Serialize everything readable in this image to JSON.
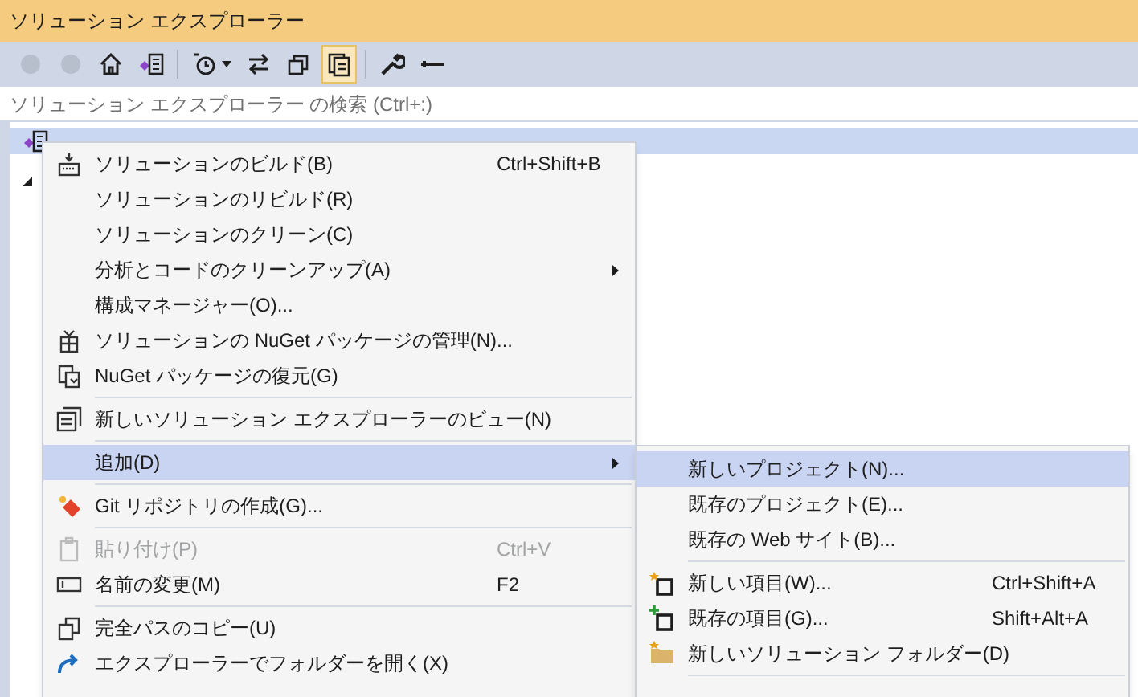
{
  "window": {
    "title": "ソリューション エクスプローラー"
  },
  "toolbar": [
    {
      "disabled": true,
      "selected": false
    },
    {
      "disabled": true,
      "selected": false
    },
    {
      "disabled": false,
      "selected": false
    },
    {
      "disabled": false,
      "selected": false
    },
    {
      "disabled": false,
      "selected": false
    },
    {
      "disabled": false,
      "selected": false
    },
    {
      "disabled": false,
      "selected": false
    },
    {
      "disabled": false,
      "selected": true
    },
    {
      "disabled": false,
      "selected": false
    },
    {
      "disabled": false,
      "selected": false
    }
  ],
  "search": {
    "placeholder": "ソリューション エクスプローラー の検索 (Ctrl+:)"
  },
  "tree": {
    "selected": true,
    "expanded": true
  },
  "context_menu": [
    {
      "kind": "item",
      "label": "ソリューションのビルド(B)",
      "shortcut": "Ctrl+Shift+B",
      "disabled": false,
      "selected": false,
      "submenu": false
    },
    {
      "kind": "item",
      "label": "ソリューションのリビルド(R)",
      "disabled": false,
      "selected": false,
      "submenu": false
    },
    {
      "kind": "item",
      "label": "ソリューションのクリーン(C)",
      "disabled": false,
      "selected": false,
      "submenu": false
    },
    {
      "kind": "item",
      "label": "分析とコードのクリーンアップ(A)",
      "disabled": false,
      "selected": false,
      "submenu": true
    },
    {
      "kind": "item",
      "label": "構成マネージャー(O)...",
      "disabled": false,
      "selected": false,
      "submenu": false
    },
    {
      "kind": "item",
      "label": "ソリューションの NuGet パッケージの管理(N)...",
      "disabled": false,
      "selected": false,
      "submenu": false
    },
    {
      "kind": "item",
      "label": "NuGet パッケージの復元(G)",
      "disabled": false,
      "selected": false,
      "submenu": false
    },
    {
      "kind": "separator"
    },
    {
      "kind": "item",
      "label": "新しいソリューション エクスプローラーのビュー(N)",
      "disabled": false,
      "selected": false,
      "submenu": false
    },
    {
      "kind": "separator"
    },
    {
      "kind": "item",
      "label": "追加(D)",
      "disabled": false,
      "selected": true,
      "submenu": true
    },
    {
      "kind": "separator"
    },
    {
      "kind": "item",
      "label": "Git リポジトリの作成(G)...",
      "disabled": false,
      "selected": false,
      "submenu": false
    },
    {
      "kind": "separator"
    },
    {
      "kind": "item",
      "label": "貼り付け(P)",
      "shortcut": "Ctrl+V",
      "disabled": true,
      "selected": false,
      "submenu": false
    },
    {
      "kind": "item",
      "label": "名前の変更(M)",
      "shortcut": "F2",
      "disabled": false,
      "selected": false,
      "submenu": false
    },
    {
      "kind": "separator"
    },
    {
      "kind": "item",
      "label": "完全パスのコピー(U)",
      "disabled": false,
      "selected": false,
      "submenu": false
    },
    {
      "kind": "item",
      "label": "エクスプローラーでフォルダーを開く(X)",
      "disabled": false,
      "selected": false,
      "submenu": false
    }
  ],
  "submenu": [
    {
      "kind": "item",
      "label": "新しいプロジェクト(N)...",
      "disabled": false,
      "selected": true,
      "submenu": false
    },
    {
      "kind": "item",
      "label": "既存のプロジェクト(E)...",
      "disabled": false,
      "selected": false,
      "submenu": false
    },
    {
      "kind": "item",
      "label": "既存の Web サイト(B)...",
      "disabled": false,
      "selected": false,
      "submenu": false
    },
    {
      "kind": "separator"
    },
    {
      "kind": "item",
      "label": "新しい項目(W)...",
      "shortcut": "Ctrl+Shift+A",
      "disabled": false,
      "selected": false,
      "submenu": false
    },
    {
      "kind": "item",
      "label": "既存の項目(G)...",
      "shortcut": "Shift+Alt+A",
      "disabled": false,
      "selected": false,
      "submenu": false
    },
    {
      "kind": "item",
      "label": "新しいソリューション フォルダー(D)",
      "disabled": false,
      "selected": false,
      "submenu": false
    },
    {
      "kind": "separator"
    }
  ]
}
